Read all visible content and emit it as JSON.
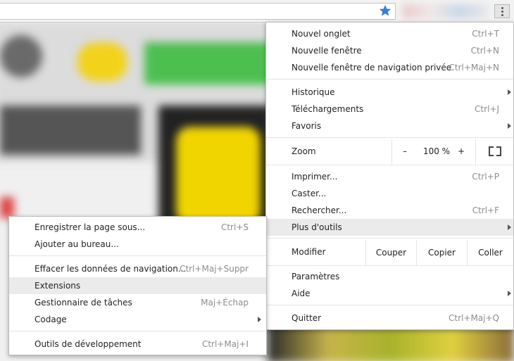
{
  "browser": {
    "accent": "#3b7ddd"
  },
  "main_menu": {
    "items": [
      {
        "label": "Nouvel onglet",
        "shortcut": "Ctrl+T"
      },
      {
        "label": "Nouvelle fenêtre",
        "shortcut": "Ctrl+N"
      },
      {
        "label": "Nouvelle fenêtre de navigation privée",
        "shortcut": "Ctrl+Maj+N"
      },
      {
        "label": "Historique",
        "shortcut": ""
      },
      {
        "label": "Téléchargements",
        "shortcut": "Ctrl+J"
      },
      {
        "label": "Favoris",
        "shortcut": ""
      },
      {
        "label": "Imprimer...",
        "shortcut": "Ctrl+P"
      },
      {
        "label": "Caster...",
        "shortcut": ""
      },
      {
        "label": "Rechercher...",
        "shortcut": "Ctrl+F"
      },
      {
        "label": "Plus d'outils",
        "shortcut": ""
      },
      {
        "label": "Paramètres",
        "shortcut": ""
      },
      {
        "label": "Aide",
        "shortcut": ""
      },
      {
        "label": "Quitter",
        "shortcut": "Ctrl+Maj+Q"
      }
    ],
    "zoom": {
      "label": "Zoom",
      "minus": "–",
      "value": "100 %",
      "plus": "+"
    },
    "edit": {
      "label": "Modifier",
      "cut": "Couper",
      "copy": "Copier",
      "paste": "Coller"
    }
  },
  "sub_menu": {
    "items": [
      {
        "label": "Enregistrer la page sous...",
        "shortcut": "Ctrl+S"
      },
      {
        "label": "Ajouter au bureau...",
        "shortcut": ""
      },
      {
        "label": "Effacer les données de navigation...",
        "shortcut": "Ctrl+Maj+Suppr"
      },
      {
        "label": "Extensions",
        "shortcut": ""
      },
      {
        "label": "Gestionnaire de tâches",
        "shortcut": "Maj+Échap"
      },
      {
        "label": "Codage",
        "shortcut": ""
      },
      {
        "label": "Outils de développement",
        "shortcut": "Ctrl+Maj+I"
      }
    ]
  }
}
